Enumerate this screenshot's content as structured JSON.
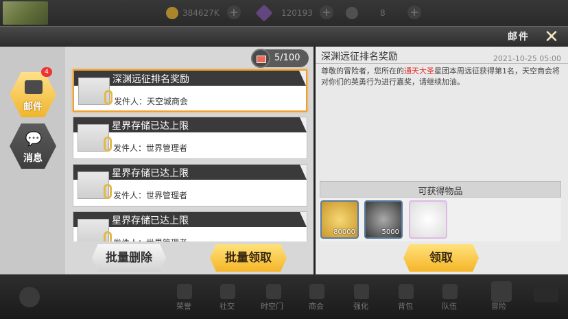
{
  "topbar": {
    "gold": "384627K",
    "crystal": "120193",
    "energy": "8"
  },
  "header": {
    "title": "邮件"
  },
  "sidebar": {
    "mail_tab": {
      "label": "邮件",
      "badge": "4"
    },
    "message_tab": {
      "label": "消息"
    }
  },
  "mailbox": {
    "count": "5/100",
    "items": [
      {
        "subject": "深渊远征排名奖励",
        "sender": "发件人：天空城商会"
      },
      {
        "subject": "星界存储已达上限",
        "sender": "发件人：世界管理者"
      },
      {
        "subject": "星界存储已达上限",
        "sender": "发件人：世界管理者"
      },
      {
        "subject": "星界存储已达上限",
        "sender": "发件人：世界管理者"
      }
    ],
    "delete_all_label": "批量删除",
    "claim_all_label": "批量领取"
  },
  "detail": {
    "title": "深渊远征排名奖励",
    "date": "2021-10-25  05:00",
    "body_pre": "尊敬的冒险者，您所在的",
    "body_highlight": "通天大圣",
    "body_post": "星团本周远征获得第1名，天空商会将对你们的英勇行为进行嘉奖，请继续加油。",
    "rewards_title": "可获得物品",
    "rewards": [
      {
        "icon": "gold-coin-icon",
        "count": "80000"
      },
      {
        "icon": "silver-medal-icon",
        "count": "5000"
      },
      {
        "icon": "winged-frame-icon",
        "count": ""
      }
    ],
    "claim_label": "领取",
    "highlight_color": "#e2312b"
  },
  "bottom_nav": [
    "荣誉",
    "社交",
    "时空门",
    "商会",
    "强化",
    "背包",
    "队伍",
    "冒险"
  ]
}
